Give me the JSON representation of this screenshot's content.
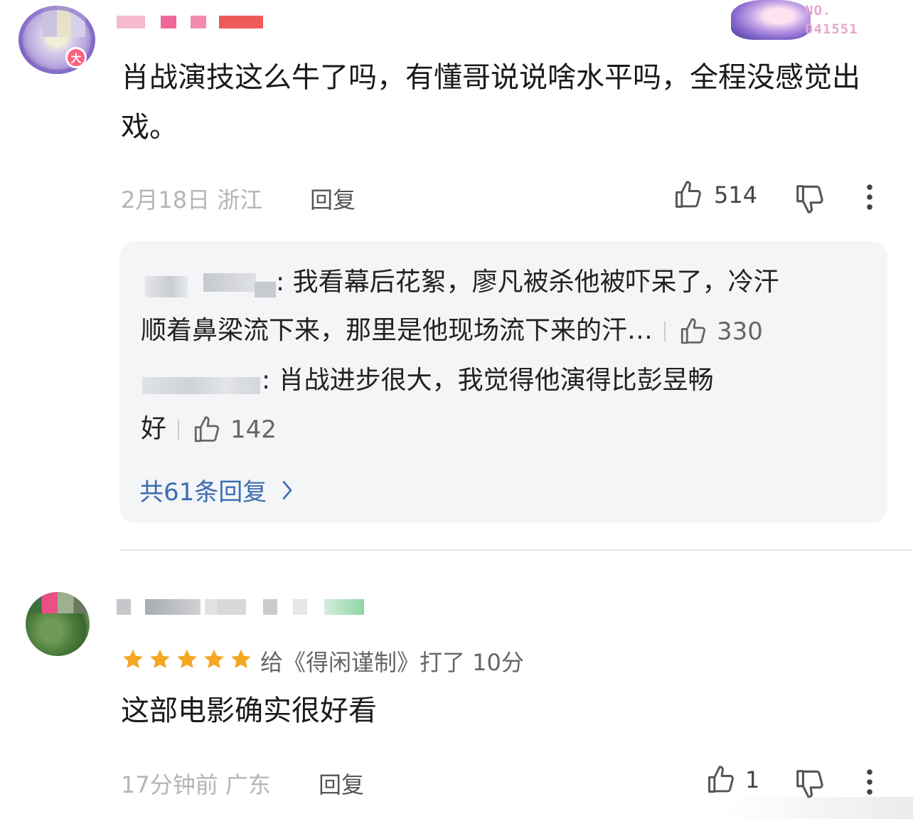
{
  "top_comment": {
    "badge_text": "NO.\n041551",
    "vip_badge": "大",
    "text": "肖战演技这么牛了吗，有懂哥说说啥水平吗，全程没感觉出戏。",
    "date": "2月18日",
    "location": "浙江",
    "reply_label": "回复",
    "like_count": "514",
    "icons": [
      "thumbs-up-icon",
      "thumbs-down-icon",
      "more-vertical-icon"
    ]
  },
  "replies": [
    {
      "text_line1": ": 我看幕后花絮，廖凡被杀他被吓呆了，冷汗",
      "text_line2": "顺着鼻梁流下来，那里是他现场流下来的汗…",
      "likes": "330"
    },
    {
      "text_line1": ": 肖战进步很大，我觉得他演得比彭昱畅",
      "text_line2": "好",
      "likes": "142"
    }
  ],
  "more_replies_label": "共61条回复",
  "second_comment": {
    "stars": 5,
    "rating_text": "给《得闲谨制》打了 10分",
    "text": "这部电影确实很好看",
    "date": "17分钟前",
    "location": "广东",
    "reply_label": "回复",
    "like_count": "1"
  },
  "colors": {
    "link_blue": "#3c6cb2",
    "star_orange": "#f5a623",
    "reply_bg": "#f3f5f7"
  }
}
